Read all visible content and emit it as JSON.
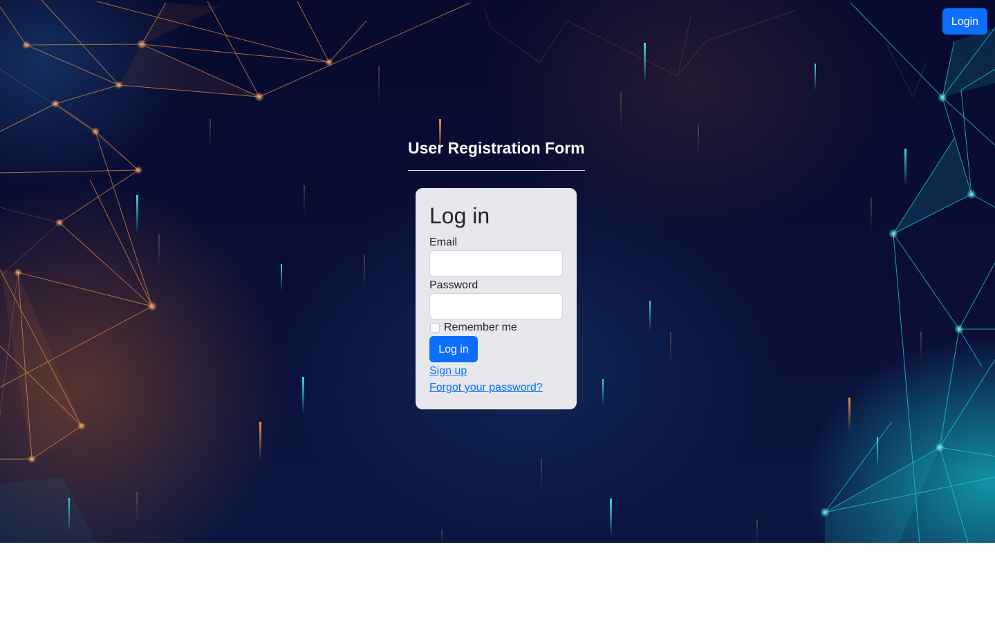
{
  "header": {
    "login_button": "Login"
  },
  "page": {
    "heading": "User Registration Form"
  },
  "login_form": {
    "title": "Log in",
    "email_label": "Email",
    "email_value": "",
    "password_label": "Password",
    "password_value": "",
    "remember_label": "Remember me",
    "remember_checked": false,
    "submit_label": "Log in",
    "signup_link": "Sign up",
    "forgot_link": "Forgot your password?"
  },
  "theme": {
    "accent": "#0d6efd",
    "card_background": "#e7e8ec",
    "hero_background": "#0a0f38"
  },
  "icons": {
    "background_art": "network-particles"
  }
}
